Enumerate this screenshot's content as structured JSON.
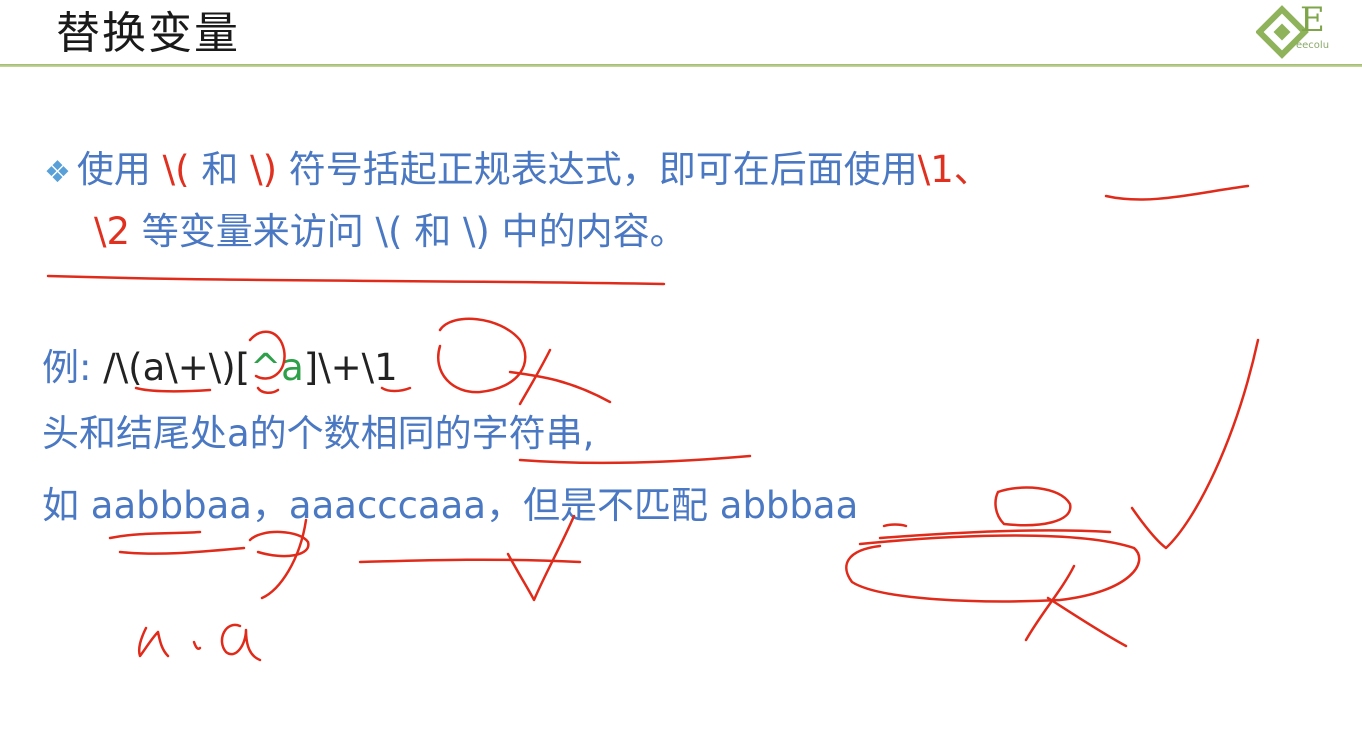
{
  "slide": {
    "title": "替换变量",
    "logo_text": "E",
    "logo_sub": "eecolu"
  },
  "desc": {
    "bullet_icon": "diamond-bullet-icon",
    "l1_a": "使用 ",
    "l1_b": "\\(",
    "l1_c": " 和 ",
    "l1_d": "\\)",
    "l1_e": " 符号括起正规表达式，即可在后面使用",
    "l1_f": "\\1",
    "l1_g": "、",
    "l2_a": "\\2",
    "l2_b": " 等变量来访问 \\( 和 \\) 中的内容。"
  },
  "example": {
    "label": "例:",
    "p1": " /\\(a\\+\\)[",
    "p2": "^a",
    "p3": "]\\+\\1",
    "line4": "头和结尾处a的个数相同的字符串,",
    "l5_a": "如 ",
    "l5_b": "aabbbaa",
    "l5_c": "，",
    "l5_d": "aaacccaaa",
    "l5_e": "，但是不匹配 ",
    "l5_f": "abbbaa"
  },
  "colors": {
    "text_blue": "#4a78c2",
    "accent_red": "#e03020",
    "regex_green": "#2ea04a",
    "title_rule_green": "#9fba6b",
    "ink_red": "#e02a1a"
  }
}
